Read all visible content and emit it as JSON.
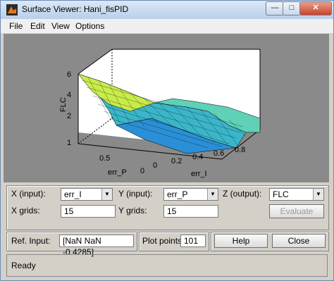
{
  "window": {
    "title": "Surface Viewer: Hani_fisPID",
    "controls": {
      "minimize": "—",
      "maximize": "□",
      "close": "✕"
    }
  },
  "menu": [
    "File",
    "Edit",
    "View",
    "Options"
  ],
  "plot": {
    "zlabel": "FLC",
    "xlabel": "err_P",
    "ylabel": "err_I",
    "z_ticks": [
      "6",
      "4",
      "2",
      "1"
    ],
    "x_ticks": [
      "0.5",
      "0"
    ],
    "y_ticks": [
      "0",
      "0.2",
      "0.4",
      "0.6",
      "0.8"
    ]
  },
  "inputs": {
    "x_input_label": "X (input):",
    "x_input_value": "err_I",
    "y_input_label": "Y (input):",
    "y_input_value": "err_P",
    "z_output_label": "Z (output):",
    "z_output_value": "FLC",
    "x_grids_label": "X grids:",
    "x_grids_value": "15",
    "y_grids_label": "Y grids:",
    "y_grids_value": "15",
    "evaluate_label": "Evaluate"
  },
  "bottom": {
    "ref_input_label": "Ref. Input:",
    "ref_input_value": "[NaN NaN -0.4285]",
    "plot_points_label": "Plot points:",
    "plot_points_value": "101",
    "help_label": "Help",
    "close_label": "Close"
  },
  "status": {
    "text": "Ready"
  },
  "colors": {
    "plot_bg": "#8a8a8a",
    "axes_bg": "#ffffff",
    "panel_bg": "#d4d0c8"
  }
}
